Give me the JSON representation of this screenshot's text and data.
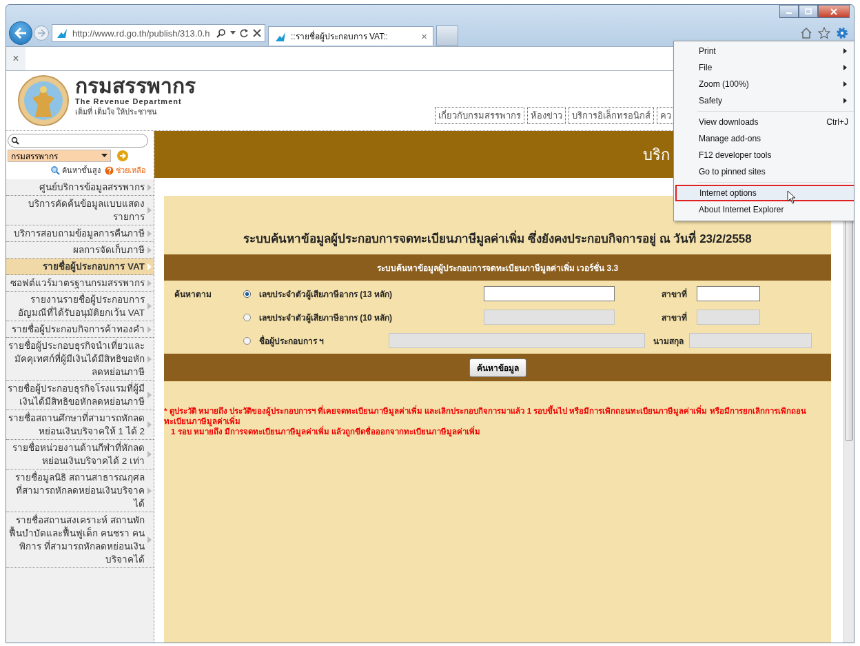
{
  "browser": {
    "address": "http://www.rd.go.th/publish/313.0.h",
    "tabs": [
      {
        "title": "::รายชื่อผู้ประกอบการ VAT::",
        "selected": true,
        "close": "×"
      }
    ],
    "bar_close": "×"
  },
  "header": {
    "title": "กรมสรรพากร",
    "subtitle": "The Revenue Department",
    "slogan": "เต็มที่ เต็มใจ ให้ประชาชน",
    "nav": [
      "เกี่ยวกับกรมสรรพากร",
      "ห้องข่าว",
      "บริการอิเล็กทรอนิกส์",
      "คว"
    ]
  },
  "sidebar": {
    "scope": "กรมสรรพากร",
    "links": [
      {
        "label": "ค้นหาขั้นสูง",
        "kind": "search"
      },
      {
        "label": "ช่วยเหลือ",
        "kind": "help"
      }
    ],
    "items": [
      {
        "label": "ศูนย์บริการข้อมูลสรรพากร",
        "selected": false
      },
      {
        "label": "บริการคัดค้นข้อมูลแบบแสดงรายการ",
        "selected": false
      },
      {
        "label": "บริการสอบถามข้อมูลการคืนภาษี",
        "selected": false
      },
      {
        "label": "ผลการจัดเก็บภาษี",
        "selected": false
      },
      {
        "label": "รายชื่อผู้ประกอบการ VAT",
        "selected": true
      },
      {
        "label": "ซอฟต์แวร์มาตรฐานกรมสรรพากร",
        "selected": false
      },
      {
        "label": "รายงานรายชื่อผู้ประกอบการอัญมณีที่ได้รับอนุมัติยกเว้น VAT",
        "selected": false
      },
      {
        "label": "รายชื่อผู้ประกอบกิจการค้าทองคำ",
        "selected": false
      },
      {
        "label": "รายชื่อผู้ประกอบธุรกิจนำเที่ยวและมัคคุเทศก์ที่ผู้มีเงินได้มีสิทธิขอหักลดหย่อนภาษี",
        "selected": false
      },
      {
        "label": "รายชื่อผู้ประกอบธุรกิจโรงแรมที่ผู้มีเงินได้มีสิทธิขอหักลดหย่อนภาษี",
        "selected": false
      },
      {
        "label": "รายชื่อสถานศึกษาที่สามารถหักลดหย่อนเงินบริจาคให้ 1 ได้ 2",
        "selected": false
      },
      {
        "label": "รายชื่อหน่วยงานด้านกีฬาที่หักลดหย่อนเงินบริจาคได้ 2 เท่า",
        "selected": false
      },
      {
        "label": "รายชื่อมูลนิธิ สถานสาธารณกุศล ที่สามารถหักลดหย่อนเงินบริจาคได้",
        "selected": false
      },
      {
        "label": "รายชื่อสถานสงเคราะห์ สถานพักฟื้นบำบัดและฟื้นฟูเด็ก คนชรา คนพิการ ที่สามารถหักลดหย่อนเงินบริจาคได้",
        "selected": false
      }
    ]
  },
  "banner": {
    "text": "บริก"
  },
  "form": {
    "title": "ระบบค้นหาข้อมูลผู้ประกอบการจดทะเบียนภาษีมูลค่าเพิ่ม ซึ่งยังคงประกอบกิจการอยู่ ณ วันที่ 23/2/2558",
    "header": "ระบบค้นหาข้อมูลผู้ประกอบการจดทะเบียนภาษีมูลค่าเพิ่ม เวอร์ชั่น 3.3",
    "search_by": "ค้นหาตาม",
    "options": [
      {
        "kind": "id",
        "label": "เลขประจำตัวผู้เสียภาษีอากร (13 หลัก)",
        "selected": true,
        "field_disabled": false,
        "side_label": "สาขาที่",
        "side_disabled": false
      },
      {
        "kind": "id",
        "label": "เลขประจำตัวผู้เสียภาษีอากร (10 หลัก)",
        "selected": false,
        "field_disabled": true,
        "side_label": "สาขาที่",
        "side_disabled": true
      },
      {
        "kind": "name",
        "label": "ชื่อผู้ประกอบการ ฯ",
        "selected": false,
        "field_disabled": true,
        "side_label": "นามสกุล",
        "side_disabled": true
      }
    ],
    "button": "ค้นหาข้อมูล",
    "notes": [
      "* ดูประวัติ หมายถึง ประวัติของผู้ประกอบการฯ ที่เคยจดทะเบียนภาษีมูลค่าเพิ่ม และเลิกประกอบกิจการมาแล้ว 1 รอบขึ้นไป หรือมีการเพิกถอนทะเบียนภาษีมูลค่าเพิ่ม หรือมีการยกเลิกการเพิกถอนทะเบียนภาษีมูลค่าเพิ่ม",
      "1 รอบ หมายถึง มีการจดทะเบียนภาษีมูลค่าเพิ่ม แล้วถูกขีดชื่อออกจากทะเบียนภาษีมูลค่าเพิ่ม"
    ]
  },
  "menu": {
    "sections": [
      [
        {
          "label": "Print",
          "kind": "submenu",
          "selected": false
        },
        {
          "label": "File",
          "kind": "submenu",
          "selected": false
        },
        {
          "label": "Zoom (100%)",
          "kind": "submenu",
          "selected": false
        },
        {
          "label": "Safety",
          "kind": "submenu",
          "selected": false
        }
      ],
      [
        {
          "label": "View downloads",
          "kind": "shortcut",
          "shortcut": "Ctrl+J",
          "selected": false
        },
        {
          "label": "Manage add-ons",
          "kind": "plain",
          "selected": false
        },
        {
          "label": "F12 developer tools",
          "kind": "plain",
          "selected": false
        },
        {
          "label": "Go to pinned sites",
          "kind": "plain",
          "selected": false
        }
      ],
      [
        {
          "label": "Internet options",
          "kind": "plain",
          "selected": true
        },
        {
          "label": "About Internet Explorer",
          "kind": "plain",
          "selected": false
        }
      ]
    ]
  }
}
